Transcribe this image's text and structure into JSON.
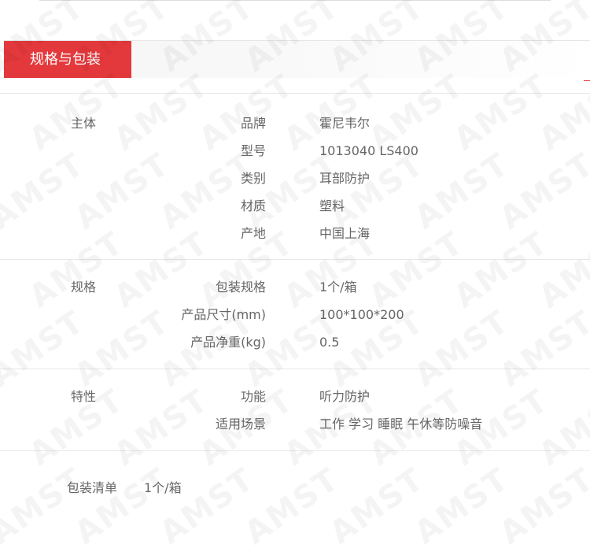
{
  "watermark_text": "AMST",
  "tab": {
    "label": "规格与包装"
  },
  "sections": [
    {
      "title": "主体",
      "rows": [
        {
          "key": "品牌",
          "value": "霍尼韦尔"
        },
        {
          "key": "型号",
          "value": "1013040 LS400"
        },
        {
          "key": "类别",
          "value": "耳部防护"
        },
        {
          "key": "材质",
          "value": "塑料"
        },
        {
          "key": "产地",
          "value": "中国上海"
        }
      ]
    },
    {
      "title": "规格",
      "rows": [
        {
          "key": "包装规格",
          "value": "1个/箱"
        },
        {
          "key": "产品尺寸(mm)",
          "value": "100*100*200"
        },
        {
          "key": "产品净重(kg)",
          "value": "0.5"
        }
      ]
    },
    {
      "title": "特性",
      "rows": [
        {
          "key": "功能",
          "value": "听力防护"
        },
        {
          "key": "适用场景",
          "value": "工作 学习 睡眠 午休等防噪音"
        }
      ]
    }
  ],
  "packing_list": {
    "label": "包装清单",
    "value": "1个/箱"
  },
  "colors": {
    "accent": "#e4393c",
    "text": "#666666",
    "divider": "#e8e8e8"
  }
}
